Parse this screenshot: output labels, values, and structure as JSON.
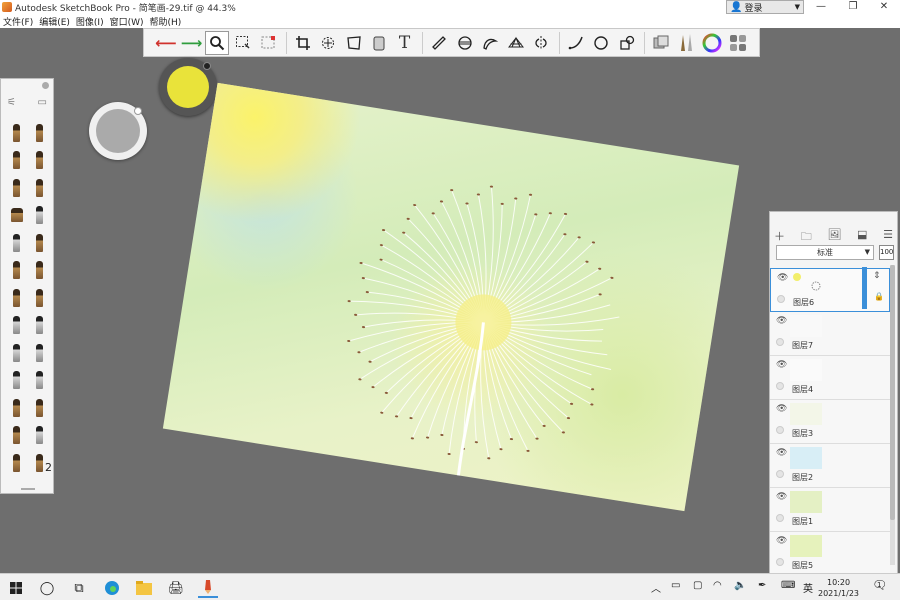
{
  "titlebar": {
    "title": "Autodesk SketchBook Pro - 简笔画-29.tif @ 44.3%",
    "login_label": "登录",
    "minimize": "—",
    "restore": "❐",
    "close": "✕"
  },
  "menu": {
    "items": [
      "文件(F)",
      "编辑(E)",
      "图像(I)",
      "窗口(W)",
      "帮助(H)"
    ]
  },
  "toolbar": {
    "buttons": [
      {
        "name": "undo-icon",
        "glyph": "↩",
        "color": "#d0322d"
      },
      {
        "name": "redo-icon",
        "glyph": "↪",
        "color": "#2f9d3e"
      },
      {
        "name": "zoom-icon",
        "glyph": "🔍"
      },
      {
        "name": "select-icon",
        "glyph": "⬚"
      },
      {
        "name": "crop-icon",
        "glyph": "⌗"
      },
      {
        "name": "transform-icon",
        "glyph": "⟲"
      },
      {
        "name": "perspective-icon",
        "glyph": "▱"
      },
      {
        "name": "fill-icon",
        "glyph": "▥"
      },
      {
        "name": "text-icon",
        "glyph": "T"
      },
      {
        "name": "ruler-icon",
        "glyph": "📏"
      },
      {
        "name": "ellipse-guide-icon",
        "glyph": "⊖"
      },
      {
        "name": "french-curve-icon",
        "glyph": "∿"
      },
      {
        "name": "perspective-grid-icon",
        "glyph": "⌂"
      },
      {
        "name": "symmetry-icon",
        "glyph": "⋈"
      },
      {
        "name": "stroke-icon",
        "glyph": "⌒"
      },
      {
        "name": "circle-icon",
        "glyph": "◯"
      },
      {
        "name": "shapes-icon",
        "glyph": "◱"
      },
      {
        "name": "layers-editor-icon",
        "glyph": "▤"
      },
      {
        "name": "brush-library-icon",
        "glyph": "✎"
      },
      {
        "name": "color-wheel-icon",
        "glyph": "◉"
      },
      {
        "name": "swatches-icon",
        "glyph": "▦"
      }
    ]
  },
  "colors": {
    "current_color": "#e9e33a",
    "accent_blue": "#3b8fd9"
  },
  "brush_panel": {
    "number_label": "2"
  },
  "layers": {
    "blend_mode": "标准",
    "opacity": "100",
    "items": [
      {
        "name": "图层6",
        "selected": true
      },
      {
        "name": "图层7",
        "selected": false
      },
      {
        "name": "图层4",
        "selected": false
      },
      {
        "name": "图层3",
        "selected": false
      },
      {
        "name": "图层2",
        "selected": false
      },
      {
        "name": "图层1",
        "selected": false
      },
      {
        "name": "图层5",
        "selected": false
      }
    ]
  },
  "taskbar": {
    "ime_label": "英",
    "time": "10:20",
    "date": "2021/1/23",
    "notification_count": "1"
  }
}
